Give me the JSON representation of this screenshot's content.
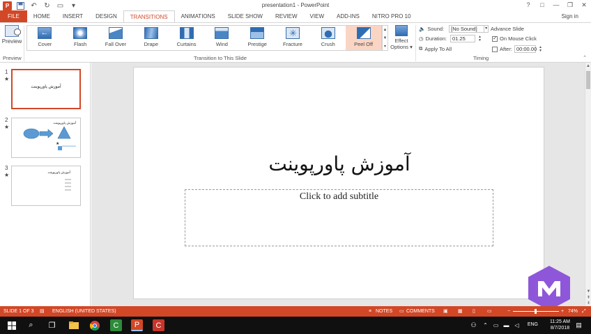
{
  "window": {
    "title": "presentation1 - PowerPoint",
    "controls": [
      "?",
      "□",
      "—",
      "❐",
      "✕"
    ]
  },
  "qat": {
    "app_icon": "P",
    "save_icon": "💾",
    "undo_icon": "↶",
    "redo_icon": "↻",
    "present_icon": "▭",
    "more_icon": "▾"
  },
  "tabs": [
    {
      "label": "FILE"
    },
    {
      "label": "HOME"
    },
    {
      "label": "INSERT"
    },
    {
      "label": "DESIGN"
    },
    {
      "label": "TRANSITIONS"
    },
    {
      "label": "ANIMATIONS"
    },
    {
      "label": "SLIDE SHOW"
    },
    {
      "label": "REVIEW"
    },
    {
      "label": "VIEW"
    },
    {
      "label": "ADD-INS"
    },
    {
      "label": "NITRO PRO 10"
    }
  ],
  "signin": "Sign in",
  "ribbon": {
    "preview": {
      "label": "Preview",
      "group": "Preview"
    },
    "transitions": [
      "Cover",
      "Flash",
      "Fall Over",
      "Drape",
      "Curtains",
      "Wind",
      "Prestige",
      "Fracture",
      "Crush",
      "Peel Off"
    ],
    "effect_options": {
      "line1": "Effect",
      "line2": "Options ▾"
    },
    "group_transition": "Transition to This Slide",
    "timing": {
      "sound_label": "Sound:",
      "sound_value": "[No Sound]",
      "duration_label": "Duration:",
      "duration_value": "01.25",
      "apply_all": "Apply To All",
      "advance_title": "Advance Slide",
      "on_mouse_click": "On Mouse Click",
      "on_mouse_checked": "✓",
      "after_label": "After:",
      "after_value": "00:00.00",
      "group": "Timing"
    }
  },
  "slides": [
    {
      "num": "1",
      "star": "★",
      "title": "آموزش پاورپوینت"
    },
    {
      "num": "2",
      "star": "★",
      "title": "آموزش پاورپوینت"
    },
    {
      "num": "3",
      "star": "★",
      "title": "آموزش پاورپوینت"
    }
  ],
  "slide": {
    "title": "آموزش پاورپوینت",
    "subtitle": "Click to add subtitle"
  },
  "statusbar": {
    "slide_info": "SLIDE 1 OF 3",
    "language": "ENGLISH (UNITED STATES)",
    "notes": "NOTES",
    "comments": "COMMENTS",
    "zoom": "74%",
    "zoom_level": 0.74
  },
  "taskbar": {
    "lang": "ENG",
    "time": "11:25 AM",
    "date": "8/7/2018"
  },
  "colors": {
    "accent": "#d24726",
    "watermark": "#8e57d9"
  }
}
